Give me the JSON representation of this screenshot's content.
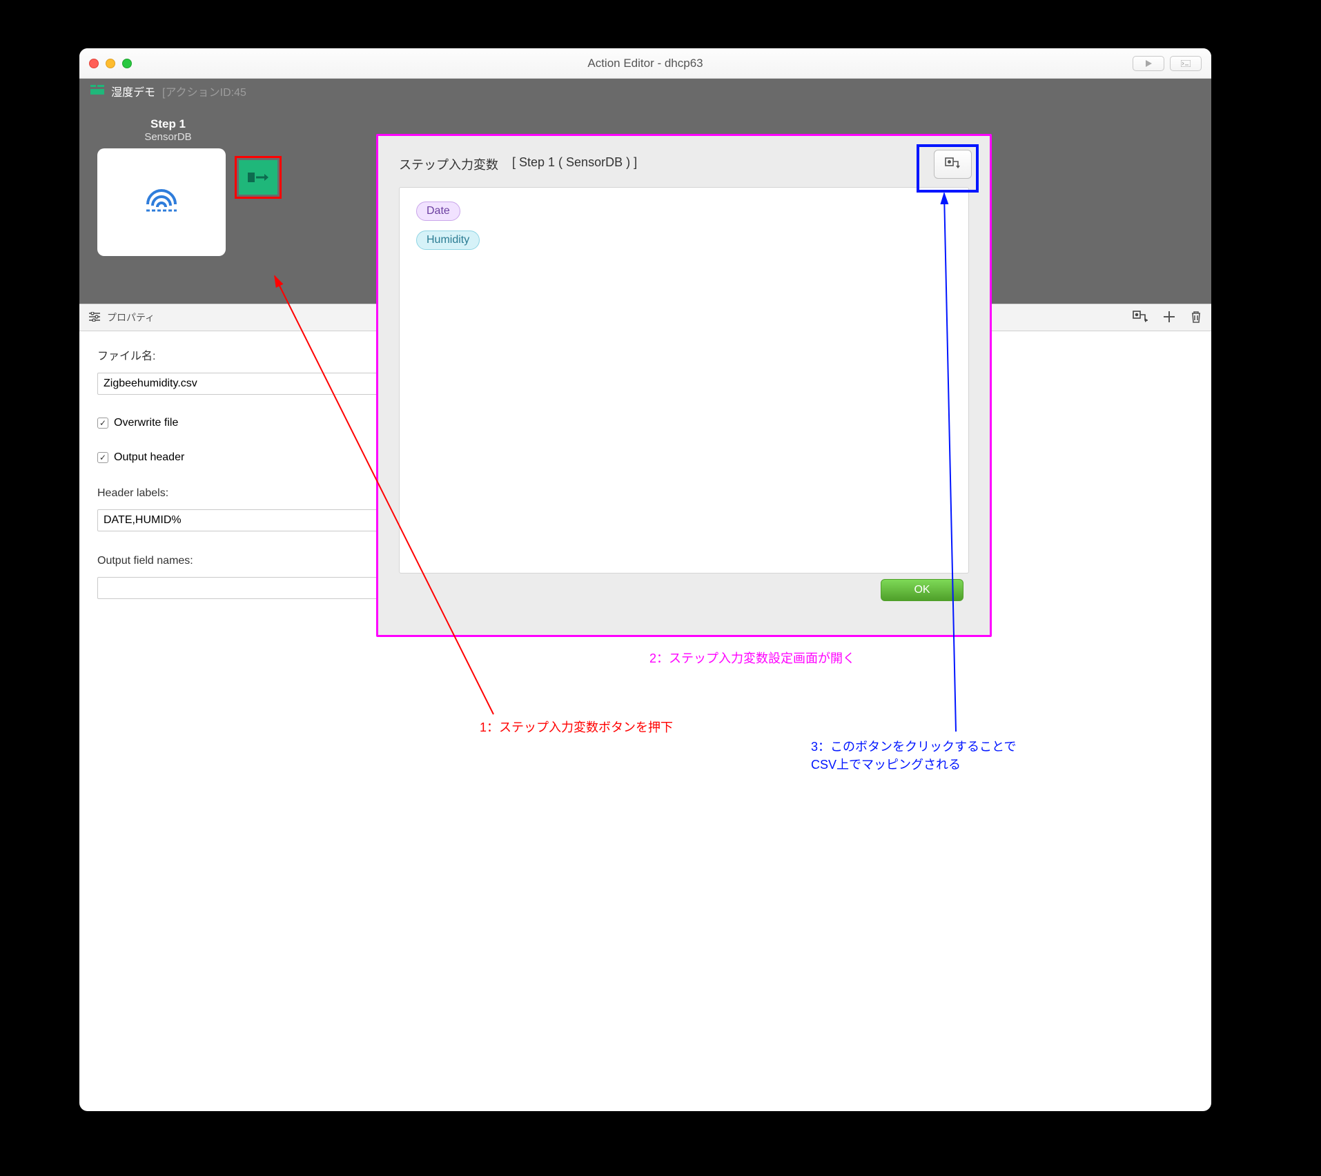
{
  "window": {
    "title": "Action Editor - dhcp63"
  },
  "breadcrumb": {
    "name": "湿度デモ",
    "id_label": "[アクションID:45"
  },
  "step": {
    "title": "Step 1",
    "subtitle": "SensorDB"
  },
  "prop_panel": {
    "header": "プロパティ"
  },
  "props": {
    "filename_label": "ファイル名:",
    "filename_value": "Zigbeehumidity.csv",
    "overwrite_label": "Overwrite file",
    "output_header_label": "Output header",
    "header_labels_label": "Header labels:",
    "header_labels_value": "DATE,HUMID%",
    "output_fields_label": "Output field names:",
    "output_fields_value": ""
  },
  "modal": {
    "title": "ステップ入力変数",
    "context": "[ Step 1 ( SensorDB ) ]",
    "tags": [
      "Date",
      "Humidity"
    ],
    "ok": "OK"
  },
  "annotations": {
    "a1": "1：ステップ入力変数ボタンを押下",
    "a2": "2：ステップ入力変数設定画面が開く",
    "a3a": "3：このボタンをクリックすることで",
    "a3b": "CSV上でマッピングされる"
  }
}
